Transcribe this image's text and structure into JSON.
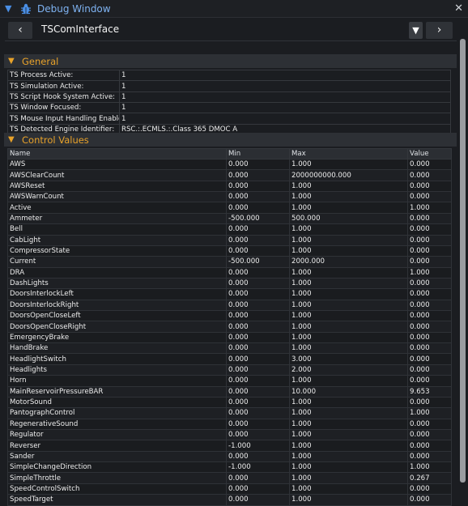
{
  "window": {
    "title": "Debug Window",
    "collapse_arrow": "▼",
    "close_glyph": "✕"
  },
  "nav": {
    "prev_label": "‹",
    "next_label": "›",
    "dropdown_glyph": "▼",
    "title": "TSComInterface"
  },
  "general": {
    "title": "General",
    "arrow": "▼",
    "rows": [
      {
        "label": "TS Process Active:",
        "value": "1"
      },
      {
        "label": "TS Simulation Active:",
        "value": "1"
      },
      {
        "label": "TS Script Hook System Active:",
        "value": "1"
      },
      {
        "label": "TS Window Focused:",
        "value": "1"
      },
      {
        "label": "TS Mouse Input Handling Enabled:",
        "value": "1"
      },
      {
        "label": "TS Detected Engine Identifier:",
        "value": "RSC.:.ECMLS.:.Class 365 DMOC A"
      }
    ]
  },
  "control_values": {
    "title": "Control Values",
    "arrow": "▼",
    "headers": [
      "Name",
      "Min",
      "Max",
      "Value"
    ],
    "rows": [
      [
        "AWS",
        "0.000",
        "1.000",
        "0.000"
      ],
      [
        "AWSClearCount",
        "0.000",
        "2000000000.000",
        "0.000"
      ],
      [
        "AWSReset",
        "0.000",
        "1.000",
        "0.000"
      ],
      [
        "AWSWarnCount",
        "0.000",
        "1.000",
        "0.000"
      ],
      [
        "Active",
        "0.000",
        "1.000",
        "1.000"
      ],
      [
        "Ammeter",
        "-500.000",
        "500.000",
        "0.000"
      ],
      [
        "Bell",
        "0.000",
        "1.000",
        "0.000"
      ],
      [
        "CabLight",
        "0.000",
        "1.000",
        "0.000"
      ],
      [
        "CompressorState",
        "0.000",
        "1.000",
        "0.000"
      ],
      [
        "Current",
        "-500.000",
        "2000.000",
        "0.000"
      ],
      [
        "DRA",
        "0.000",
        "1.000",
        "1.000"
      ],
      [
        "DashLights",
        "0.000",
        "1.000",
        "0.000"
      ],
      [
        "DoorsInterlockLeft",
        "0.000",
        "1.000",
        "0.000"
      ],
      [
        "DoorsInterlockRight",
        "0.000",
        "1.000",
        "0.000"
      ],
      [
        "DoorsOpenCloseLeft",
        "0.000",
        "1.000",
        "0.000"
      ],
      [
        "DoorsOpenCloseRight",
        "0.000",
        "1.000",
        "0.000"
      ],
      [
        "EmergencyBrake",
        "0.000",
        "1.000",
        "0.000"
      ],
      [
        "HandBrake",
        "0.000",
        "1.000",
        "0.000"
      ],
      [
        "HeadlightSwitch",
        "0.000",
        "3.000",
        "0.000"
      ],
      [
        "Headlights",
        "0.000",
        "2.000",
        "0.000"
      ],
      [
        "Horn",
        "0.000",
        "1.000",
        "0.000"
      ],
      [
        "MainReservoirPressureBAR",
        "0.000",
        "10.000",
        "9.653"
      ],
      [
        "MotorSound",
        "0.000",
        "1.000",
        "0.000"
      ],
      [
        "PantographControl",
        "0.000",
        "1.000",
        "1.000"
      ],
      [
        "RegenerativeSound",
        "0.000",
        "1.000",
        "0.000"
      ],
      [
        "Regulator",
        "0.000",
        "1.000",
        "0.000"
      ],
      [
        "Reverser",
        "-1.000",
        "1.000",
        "0.000"
      ],
      [
        "Sander",
        "0.000",
        "1.000",
        "0.000"
      ],
      [
        "SimpleChangeDirection",
        "-1.000",
        "1.000",
        "1.000"
      ],
      [
        "SimpleThrottle",
        "0.000",
        "1.000",
        "0.267"
      ],
      [
        "SpeedControlSwitch",
        "0.000",
        "1.000",
        "0.000"
      ],
      [
        "SpeedTarget",
        "0.000",
        "1.000",
        "0.000"
      ]
    ]
  },
  "colors": {
    "accent": "#e8a22a",
    "title_blue": "#7fb3f2",
    "background": "#1b1d21"
  }
}
